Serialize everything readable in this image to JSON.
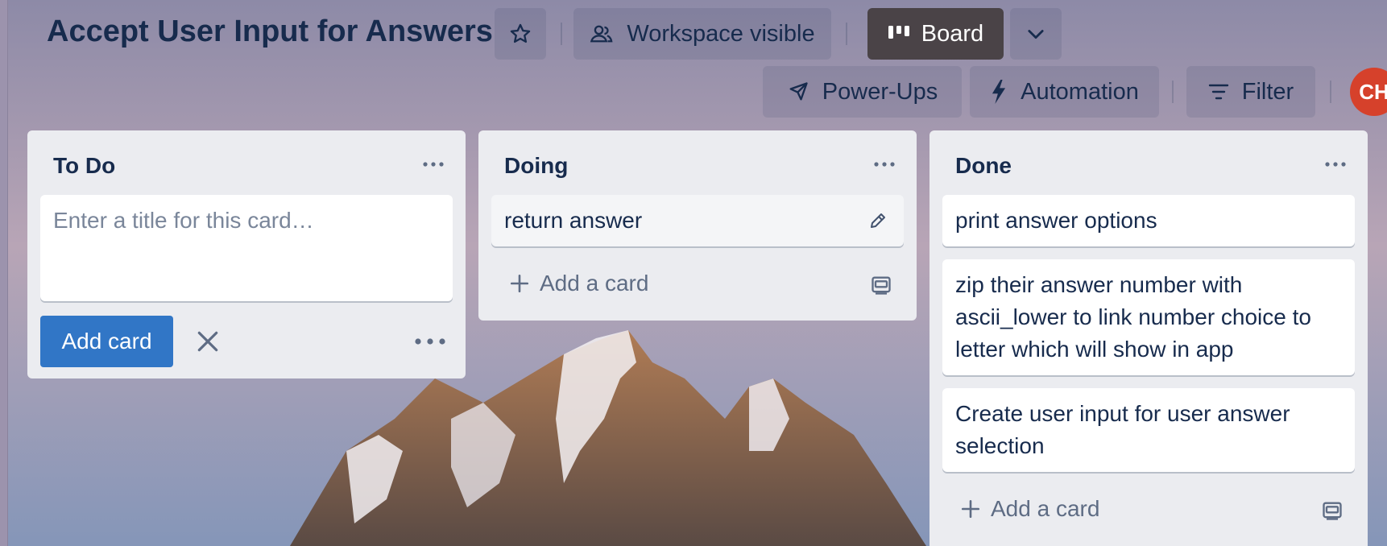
{
  "board": {
    "title": "Accept User Input for Answers",
    "visibility_label": "Workspace visible",
    "view_label": "Board",
    "powerups_label": "Power-Ups",
    "automation_label": "Automation",
    "filter_label": "Filter",
    "avatar_initials": "CH"
  },
  "lists": {
    "todo": {
      "title": "To Do",
      "input_placeholder": "Enter a title for this card…",
      "add_button_label": "Add card"
    },
    "doing": {
      "title": "Doing",
      "cards": [
        "return answer"
      ],
      "add_card_label": "Add a card"
    },
    "done": {
      "title": "Done",
      "cards": [
        "print answer options",
        "zip their answer number with ascii_lower to link number choice to letter which will show in app",
        "Create user input for user answer selection"
      ],
      "add_card_label": "Add a card"
    }
  },
  "colors": {
    "list_bg": "#ebecf0",
    "primary": "#3176c6",
    "text": "#172b4d",
    "avatar": "#d6412b"
  },
  "icons": {
    "star": "star-icon",
    "visibility": "people-icon",
    "board": "board-icon",
    "chevron": "chevron-down-icon",
    "powerups": "rocket-icon",
    "automation": "lightning-icon",
    "filter": "filter-icon",
    "list_menu": "more-horizontal-icon",
    "edit": "pencil-icon",
    "close": "close-icon",
    "add": "plus-icon",
    "template": "card-template-icon"
  }
}
